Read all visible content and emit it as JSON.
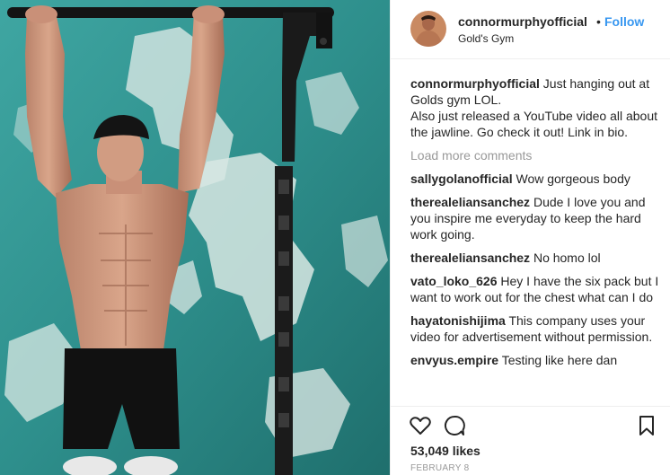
{
  "header": {
    "username": "connormurphyofficial",
    "separator": "•",
    "follow_label": "Follow",
    "location": "Gold's Gym"
  },
  "caption": {
    "username": "connormurphyofficial",
    "text_line1": "Just hanging out at Golds gym LOL.",
    "text_line2": "Also just released a YouTube video all about the jawline. Go check it out! Link in bio."
  },
  "load_more_label": "Load more comments",
  "comments": [
    {
      "username": "sallygolanofficial",
      "text": "Wow gorgeous body"
    },
    {
      "username": "therealeliansanchez",
      "text": "Dude I love you and you inspire me everyday to keep the hard work going."
    },
    {
      "username": "therealeliansanchez",
      "text": "No homo lol"
    },
    {
      "username": "vato_loko_626",
      "text": "Hey I have the six pack but I want to work out for the chest what can I do"
    },
    {
      "username": "hayatonishijima",
      "text": "This company uses your video for advertisement without permission."
    },
    {
      "username": "envyus.empire",
      "text": "Testing like here dan"
    }
  ],
  "actions": {
    "like_icon": "heart-icon",
    "comment_icon": "comment-bubble-icon",
    "save_icon": "bookmark-icon"
  },
  "likes_text": "53,049 likes",
  "date_text": "FEBRUARY 8",
  "colors": {
    "link_blue": "#3897f0",
    "text": "#262626",
    "muted": "#999999",
    "wall_teal": "#2e8f8c"
  }
}
